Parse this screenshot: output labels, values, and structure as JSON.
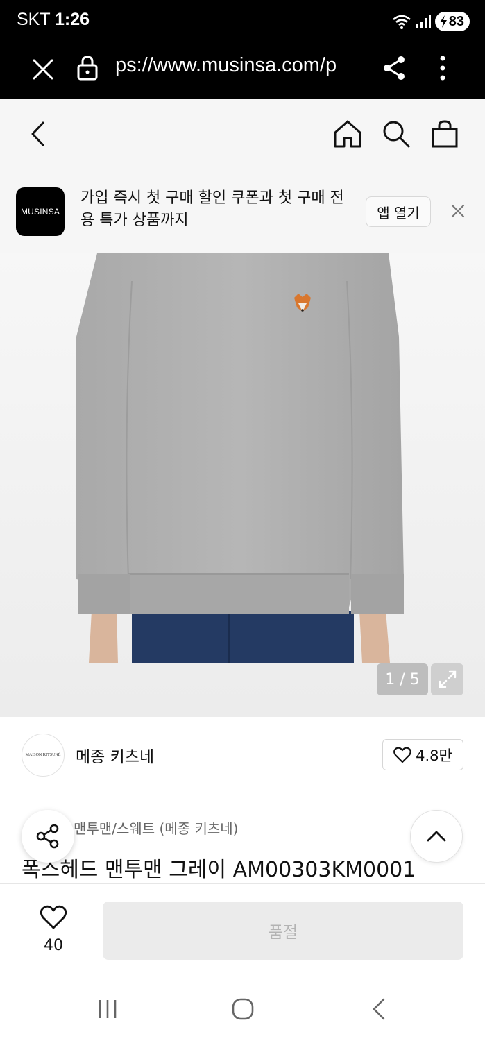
{
  "status_bar": {
    "carrier": "SKT",
    "time": "1:26",
    "battery": "83"
  },
  "browser": {
    "url": "ps://www.musinsa.com/p"
  },
  "app_banner": {
    "logo": "MUSINSA",
    "text": "가입 즉시 첫 구매 할인 쿠폰과 첫 구매 전용 특가 상품까지",
    "open_label": "앱 열기"
  },
  "gallery": {
    "counter": "1 / 5"
  },
  "brand": {
    "name": "메종 키츠네",
    "logo_text": "MAISON KITSUNÉ",
    "likes": "4.8만"
  },
  "product": {
    "category": "맨투맨/스웨트 (메종 키츠네)",
    "title": "폭스헤드 맨투맨 그레이 AM00303KM0001"
  },
  "purchase": {
    "wish_count": "40",
    "button_label": "품절"
  },
  "colors": {
    "accent": "#000000",
    "sold_out_bg": "#ebebeb"
  }
}
